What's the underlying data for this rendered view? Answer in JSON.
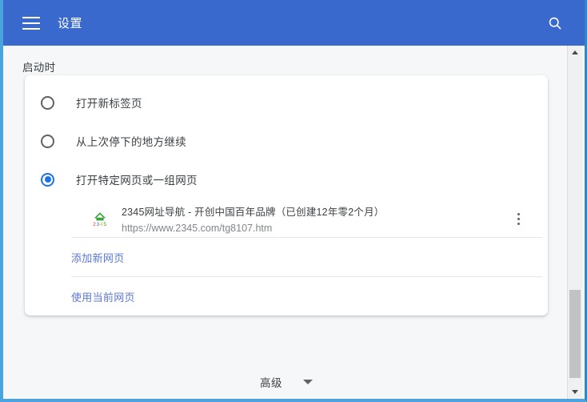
{
  "app_bar": {
    "menu_icon": "hamburger-menu-icon",
    "title": "设置",
    "search_icon": "search-icon",
    "background_color": "#3a69ce"
  },
  "section": {
    "heading": "启动时"
  },
  "startup_options": [
    {
      "label": "打开新标签页",
      "selected": false
    },
    {
      "label": "从上次停下的地方继续",
      "selected": false
    },
    {
      "label": "打开特定网页或一组网页",
      "selected": true
    }
  ],
  "site_entry": {
    "favicon": "2345-navigation-favicon",
    "title": "2345网址导航 - 开创中国百年品牌（已创建12年零2个月）",
    "url": "https://www.2345.com/tg8107.htm",
    "menu_icon": "more-vertical-icon"
  },
  "card_links": [
    {
      "label": "添加新网页"
    },
    {
      "label": "使用当前网页"
    }
  ],
  "advanced": {
    "label": "高级",
    "chevron_icon": "chevron-down-icon"
  },
  "scrollbar": {
    "up_icon": "scroll-up-arrow-icon",
    "down_icon": "scroll-down-arrow-icon"
  },
  "colors": {
    "accent": "#1a73e8",
    "app_bar": "#3a69ce",
    "link": "#5b77d6",
    "page_background": "#f6f7f9",
    "card_background": "#ffffff",
    "window_border": "#4aa3dd"
  }
}
